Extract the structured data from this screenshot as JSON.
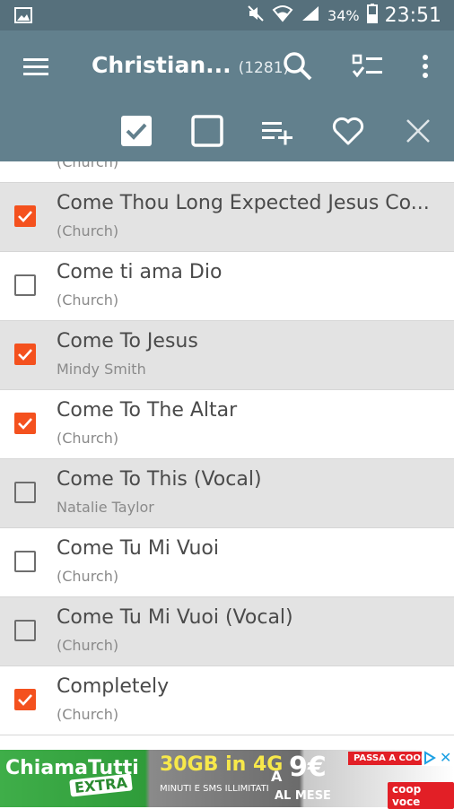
{
  "status_bar": {
    "battery": "34%",
    "time": "23:51"
  },
  "toolbar": {
    "title": "Christian...",
    "count": "(1281)"
  },
  "list": {
    "partial_artist": "(Church)",
    "items": [
      {
        "title": "Come Thou Long Expected Jesus Co...",
        "artist": "(Church)",
        "checked": true
      },
      {
        "title": "Come ti ama Dio",
        "artist": "(Church)",
        "checked": false
      },
      {
        "title": "Come To Jesus",
        "artist": "Mindy Smith",
        "checked": true
      },
      {
        "title": "Come To The Altar",
        "artist": "(Church)",
        "checked": true
      },
      {
        "title": "Come To This (Vocal)",
        "artist": "Natalie Taylor",
        "checked": false
      },
      {
        "title": "Come Tu Mi Vuoi",
        "artist": "(Church)",
        "checked": false
      },
      {
        "title": "Come Tu Mi Vuoi (Vocal)",
        "artist": "(Church)",
        "checked": false
      },
      {
        "title": "Completely",
        "artist": "(Church)",
        "checked": true
      }
    ]
  },
  "ad": {
    "brand": "ChiamaTutti",
    "brand_sub": "EXTRA",
    "data": "30GB in 4G",
    "minutes": "MINUTI E SMS ILLIMITATI",
    "price_prefix": "A",
    "price": "9€",
    "per": "AL MESE",
    "cta": "PASSA A COOP",
    "logo": "coop voce"
  },
  "colors": {
    "accent": "#f4511e",
    "toolbar": "#62808d",
    "statusbar": "#56707c"
  }
}
